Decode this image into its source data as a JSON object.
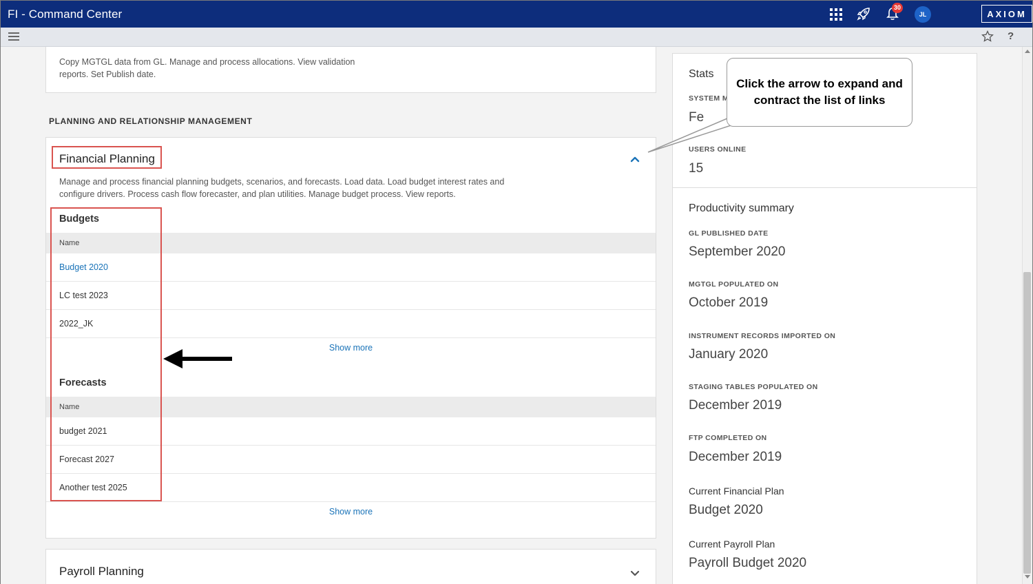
{
  "window": {
    "title": "FI - Command Center",
    "notification_count": "30",
    "user_initials": "JL",
    "brand": "AXIOM"
  },
  "toolbar": {
    "menu_icon": "hamburger-menu-icon",
    "favorite_icon": "star-icon",
    "help_label": "?"
  },
  "top_card": {
    "description": "Copy MGTGL data from GL. Manage and process allocations. View validation reports. Set Publish date."
  },
  "section": {
    "label": "PLANNING AND RELATIONSHIP MANAGEMENT"
  },
  "financial_planning": {
    "title": "Financial Planning",
    "description": "Manage and process financial planning budgets, scenarios, and forecasts. Load data. Load budget interest rates and configure drivers. Process cash flow forecaster, and plan utilities. Manage budget process. View reports.",
    "budgets": {
      "title": "Budgets",
      "column_header": "Name",
      "items": [
        "Budget 2020",
        "LC test 2023",
        "2022_JK"
      ],
      "show_more": "Show more"
    },
    "forecasts": {
      "title": "Forecasts",
      "column_header": "Name",
      "items": [
        "budget 2021",
        "Forecast 2027",
        "Another test 2025"
      ],
      "show_more": "Show more"
    }
  },
  "payroll_planning": {
    "title": "Payroll Planning"
  },
  "stats": {
    "title": "Stats",
    "system_label": "SYSTEM M",
    "system_value": "Fe",
    "users_online_label": "USERS ONLINE",
    "users_online_value": "15"
  },
  "productivity": {
    "title": "Productivity summary",
    "items": [
      {
        "label": "GL PUBLISHED DATE",
        "value": "September 2020"
      },
      {
        "label": "MGTGL POPULATED ON",
        "value": "October 2019"
      },
      {
        "label": "INSTRUMENT RECORDS IMPORTED ON",
        "value": "January 2020"
      },
      {
        "label": "STAGING TABLES POPULATED ON",
        "value": "December 2019"
      },
      {
        "label": "FTP COMPLETED ON",
        "value": "December 2019"
      }
    ],
    "current_financial_plan_label": "Current Financial Plan",
    "current_financial_plan_value": "Budget 2020",
    "current_payroll_plan_label": "Current Payroll Plan",
    "current_payroll_plan_value": "Payroll Budget 2020"
  },
  "annotation": {
    "callout_text": "Click the arrow to expand and contract the list of links",
    "highlight_color": "#d9534f"
  },
  "colors": {
    "titlebar": "#0d2d7c",
    "link": "#1a73b8",
    "avatar": "#1e63c7",
    "badge": "#e53935"
  }
}
